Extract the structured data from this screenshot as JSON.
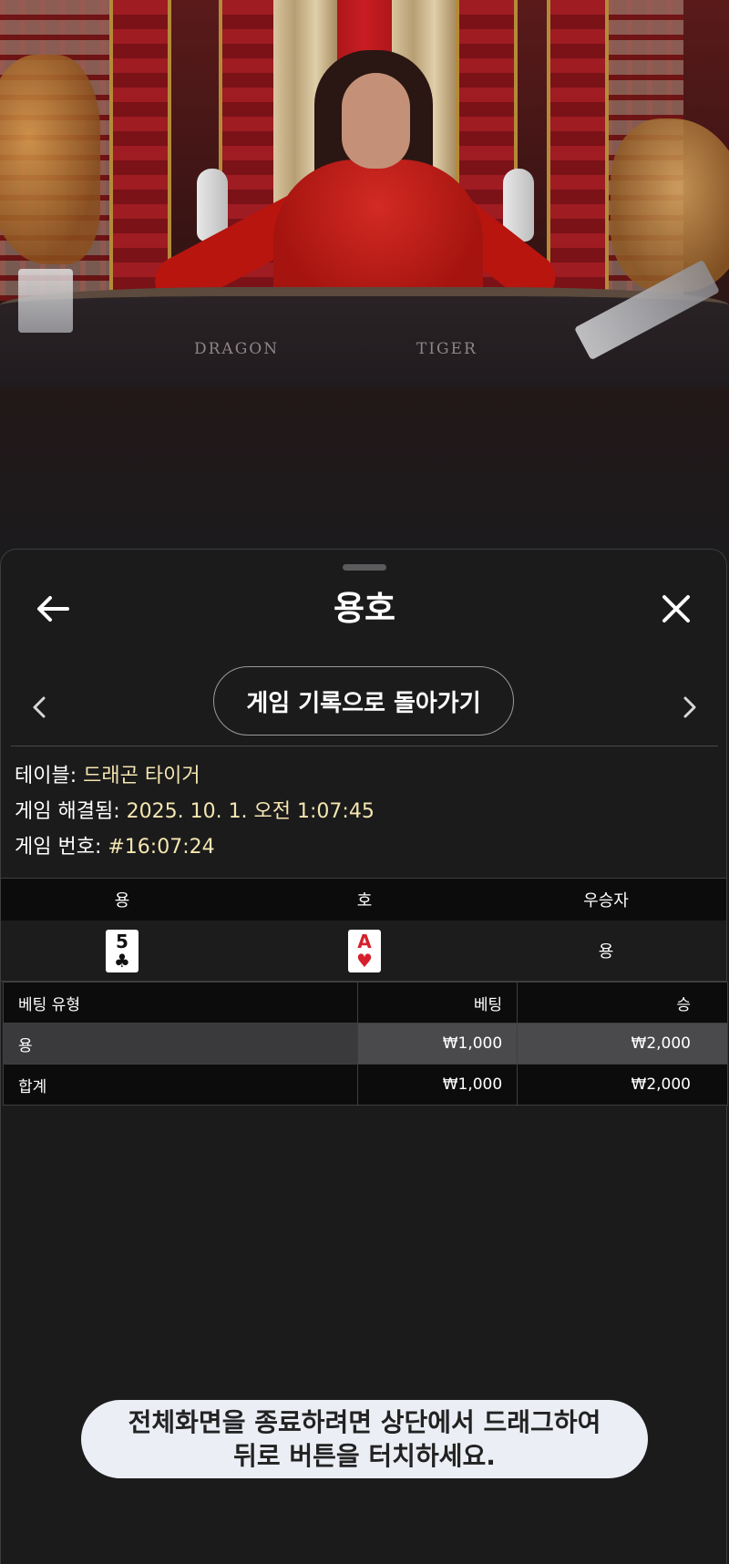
{
  "video": {
    "table_labels": [
      "DRAGON",
      "TIGER"
    ]
  },
  "sheet": {
    "title": "용호",
    "history_button": "게임 기록으로 돌아가기",
    "info": [
      {
        "label": "테이블: ",
        "value": "드래곤 타이거"
      },
      {
        "label": "게임 해결됨: ",
        "value": "2025. 10. 1. 오전 1:07:45"
      },
      {
        "label": "게임 번호: ",
        "value": "#16:07:24"
      }
    ],
    "cards_headers": [
      "용",
      "호",
      "우승자"
    ],
    "dragon_card": {
      "rank": "5",
      "suit": "♣",
      "color": "#111111"
    },
    "tiger_card": {
      "rank": "A",
      "suit": "♥",
      "color": "#d6202c"
    },
    "winner": "용",
    "bets_table": {
      "headers": [
        "베팅 유형",
        "베팅",
        "승"
      ],
      "rows": [
        [
          "용",
          "₩1,000",
          "₩2,000"
        ],
        [
          "합계",
          "₩1,000",
          "₩2,000"
        ]
      ]
    }
  },
  "toast": {
    "line1": "전체화면을 종료하려면 상단에서 드래그하여",
    "line2": "뒤로 버튼을 터치하세요."
  },
  "icons": {
    "back": "arrow-left-icon",
    "close": "close-icon",
    "prev": "chevron-left-icon",
    "next": "chevron-right-icon"
  }
}
